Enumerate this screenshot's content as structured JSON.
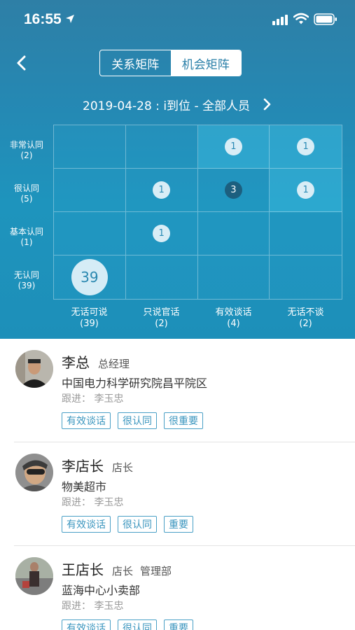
{
  "status_bar": {
    "time": "16:55"
  },
  "nav": {
    "tabs": [
      "关系矩阵",
      "机会矩阵"
    ],
    "active_tab": 1
  },
  "filter": {
    "date_text": "2019-04-28 : i到位 - 全部人员"
  },
  "matrix": {
    "rows": [
      {
        "label": "非常认同",
        "count": "(2)"
      },
      {
        "label": "很认同",
        "count": "(5)"
      },
      {
        "label": "基本认同",
        "count": "(1)"
      },
      {
        "label": "无认同",
        "count": "(39)"
      }
    ],
    "columns": [
      {
        "label": "无话可说",
        "count": "(39)"
      },
      {
        "label": "只说官话",
        "count": "(2)"
      },
      {
        "label": "有效谈话",
        "count": "(4)"
      },
      {
        "label": "无话不谈",
        "count": "(2)"
      }
    ],
    "cells": [
      [
        "",
        "",
        "1",
        "1"
      ],
      [
        "",
        "1",
        "3",
        "1"
      ],
      [
        "",
        "1",
        "",
        ""
      ],
      [
        "39",
        "",
        "",
        ""
      ]
    ]
  },
  "contacts": [
    {
      "name": "李总",
      "role": "总经理",
      "dept": "",
      "company": "中国电力科学研究院昌平院区",
      "follow": "跟进：  李玉忠",
      "tags": [
        "有效谈话",
        "很认同",
        "很重要"
      ]
    },
    {
      "name": "李店长",
      "role": "店长",
      "dept": "",
      "company": "物美超市",
      "follow": "跟进：  李玉忠",
      "tags": [
        "有效谈话",
        "很认同",
        "重要"
      ]
    },
    {
      "name": "王店长",
      "role": "店长",
      "dept": "管理部",
      "company": "蓝海中心小卖部",
      "follow": "跟进：  李玉忠",
      "tags": [
        "有效谈话",
        "很认同",
        "重要"
      ]
    }
  ]
}
